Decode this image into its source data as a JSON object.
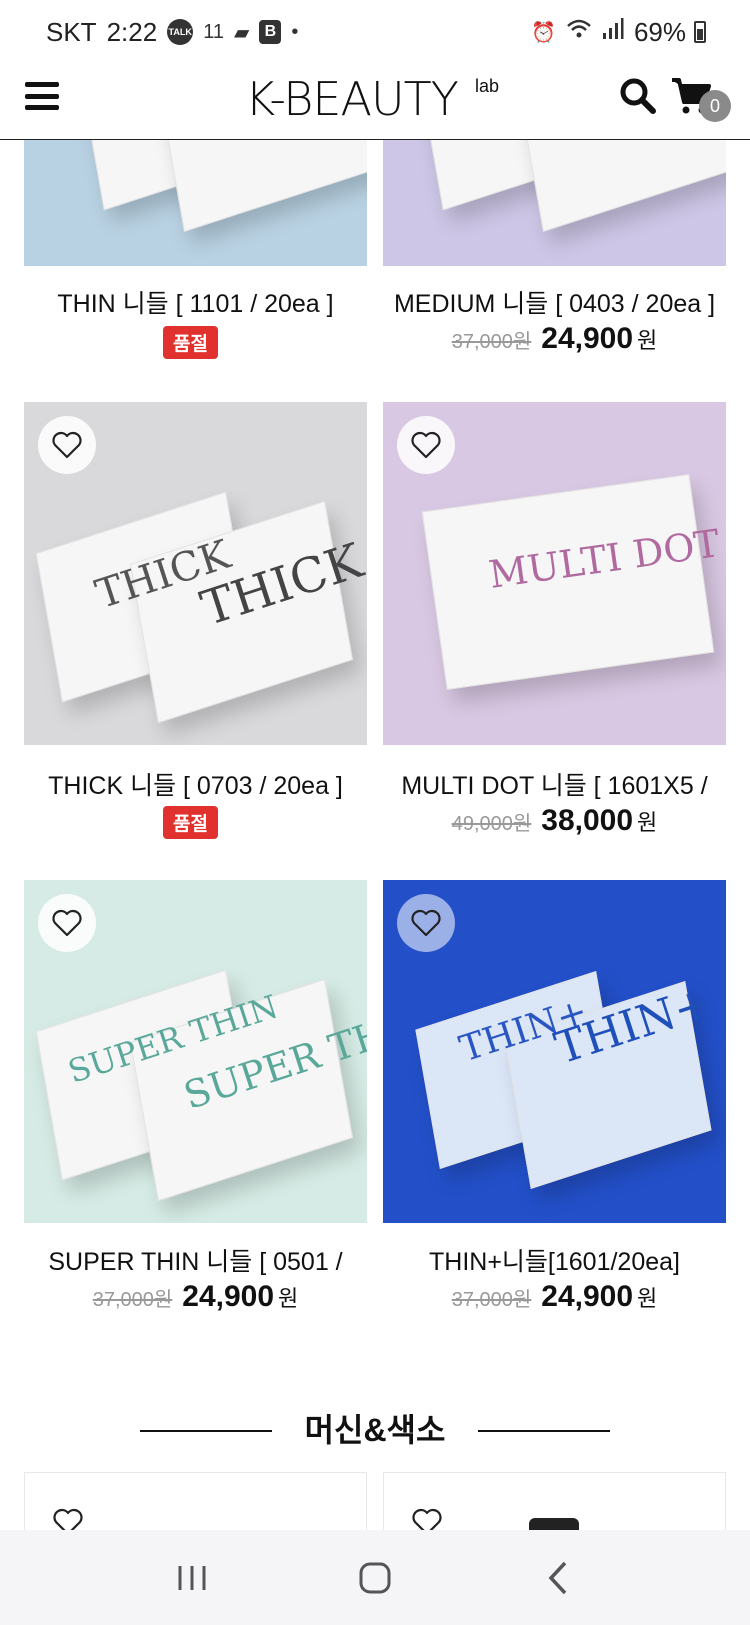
{
  "status": {
    "carrier": "SKT",
    "time": "2:22",
    "battery": "69%",
    "talk_icon": "TALK",
    "eleven_icon": "11",
    "blog_icon": "B"
  },
  "header": {
    "logo": "K-BEAUTY",
    "logo_sup": "lab",
    "cart_count": "0"
  },
  "products": [
    {
      "name": "THIN 니들 [ 1101 / 20ea ]",
      "soldout": "품절",
      "orig": "",
      "sale": "",
      "won": "",
      "bg": "#b9d2e3",
      "box_label": ""
    },
    {
      "name": "MEDIUM 니들 [ 0403 / 20ea ]",
      "soldout": "",
      "orig": "37,000원",
      "sale": "24,900",
      "won": "원",
      "bg": "#cdc6e6",
      "box_label": ""
    },
    {
      "name": "THICK 니들 [ 0703 / 20ea ]",
      "soldout": "품절",
      "orig": "",
      "sale": "",
      "won": "",
      "bg": "#d9d9dc",
      "box_label": "THICK"
    },
    {
      "name": "MULTI DOT 니들 [ 1601X5 /",
      "soldout": "",
      "orig": "49,000원",
      "sale": "38,000",
      "won": "원",
      "bg": "#d9c8e3",
      "box_label": "MULTI DOT"
    },
    {
      "name": "SUPER THIN 니들 [ 0501 /",
      "soldout": "",
      "orig": "37,000원",
      "sale": "24,900",
      "won": "원",
      "bg": "#d6ebe5",
      "box_label": "SUPER THIN"
    },
    {
      "name": "THIN+니들[1601/20ea]",
      "soldout": "",
      "orig": "37,000원",
      "sale": "24,900",
      "won": "원",
      "bg": "#2350c9",
      "box_label": "THIN+"
    }
  ],
  "section": {
    "title": "머신&색소"
  },
  "colors": {
    "soldout": "#e0312f",
    "accent_blue": "#2350c9"
  }
}
